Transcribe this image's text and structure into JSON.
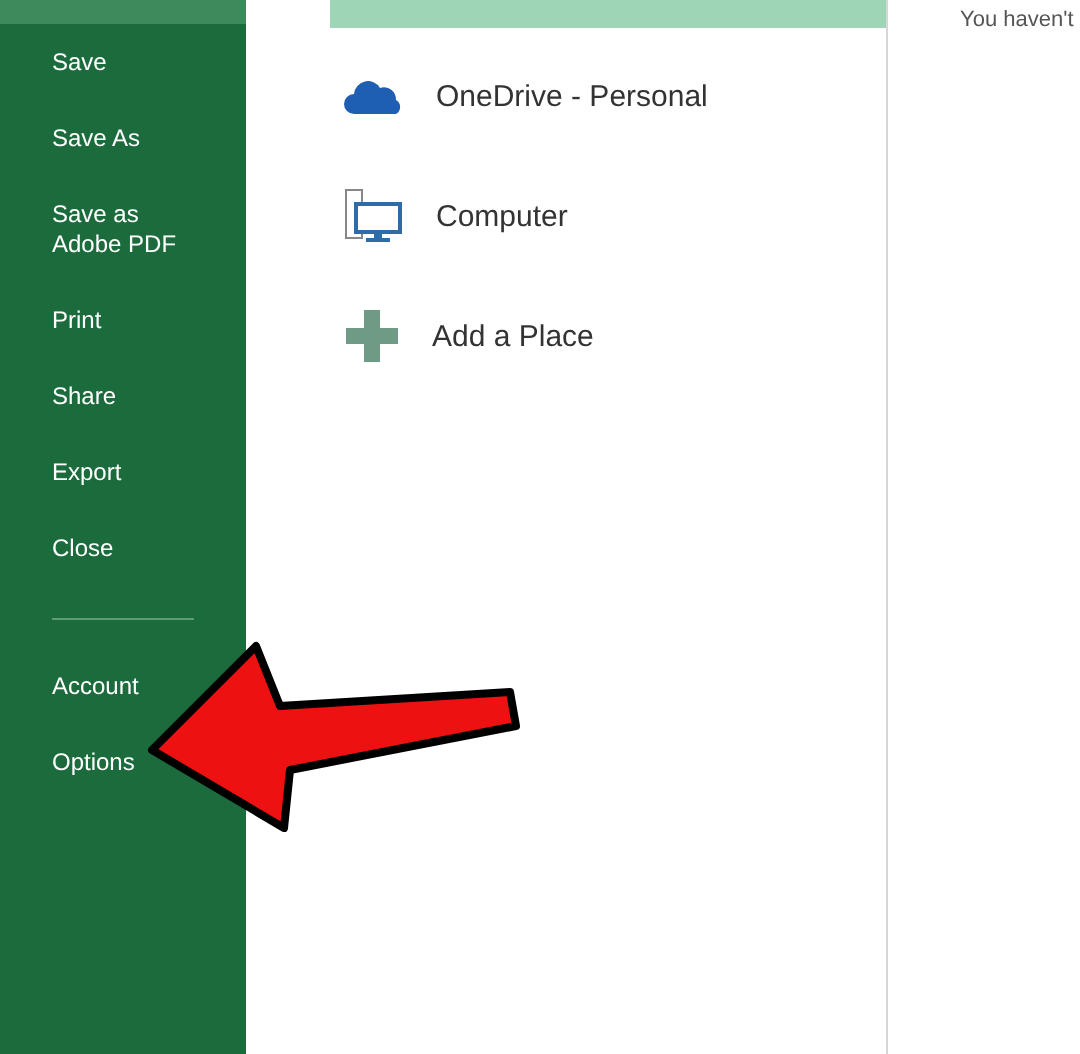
{
  "sidebar": {
    "items": [
      {
        "label": "Save",
        "selected": false
      },
      {
        "label": "Save As",
        "selected": false
      },
      {
        "label": "Save as Adobe PDF",
        "selected": false
      },
      {
        "label": "Print",
        "selected": false
      },
      {
        "label": "Share",
        "selected": false
      },
      {
        "label": "Export",
        "selected": false
      },
      {
        "label": "Close",
        "selected": false
      },
      {
        "kind": "divider"
      },
      {
        "label": "Account",
        "selected": false
      },
      {
        "label": "Options",
        "selected": false
      }
    ]
  },
  "places": [
    {
      "label": "OneDrive - Personal",
      "kind": "cloud",
      "selected": false
    },
    {
      "label": "Computer",
      "kind": "computer",
      "selected": false
    },
    {
      "label": "Add a Place",
      "kind": "add",
      "selected": false
    }
  ],
  "recent": {
    "message": "You haven't"
  }
}
